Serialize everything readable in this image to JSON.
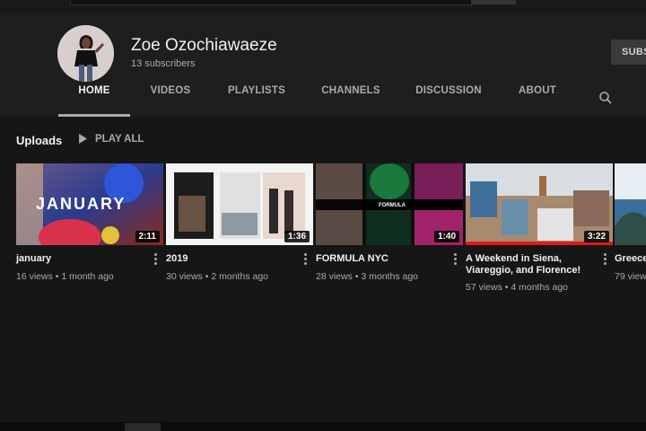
{
  "channel": {
    "name": "Zoe Ozochiawaeze",
    "subscribers": "13 subscribers",
    "subscribe_label": "SUBS"
  },
  "tabs": [
    {
      "label": "HOME",
      "active": true
    },
    {
      "label": "VIDEOS"
    },
    {
      "label": "PLAYLISTS"
    },
    {
      "label": "CHANNELS"
    },
    {
      "label": "DISCUSSION"
    },
    {
      "label": "ABOUT"
    }
  ],
  "shelf": {
    "title": "Uploads",
    "play_all": "PLAY ALL"
  },
  "thumb_text": {
    "january": "JANUARY",
    "formula": "FORMULA"
  },
  "videos": [
    {
      "title": "january",
      "views": "16 views",
      "age": "1 month ago",
      "duration": "2:11"
    },
    {
      "title": "2019",
      "views": "30 views",
      "age": "2 months ago",
      "duration": "1:36"
    },
    {
      "title": "FORMULA NYC",
      "views": "28 views",
      "age": "3 months ago",
      "duration": "1:40"
    },
    {
      "title": "A Weekend in Siena, Viareggio, and Florence!",
      "views": "57 views",
      "age": "4 months ago",
      "duration": "3:22"
    },
    {
      "title": "Greece",
      "views": "79 views",
      "age": "",
      "duration": ""
    }
  ],
  "icons": {
    "search": "search-icon",
    "play": "play-icon",
    "more": "more-vert-icon"
  },
  "colors": {
    "background": "#131313",
    "header": "#1e1e1e",
    "text": "#f1f1f1",
    "secondary_text": "#aaaaaa"
  }
}
